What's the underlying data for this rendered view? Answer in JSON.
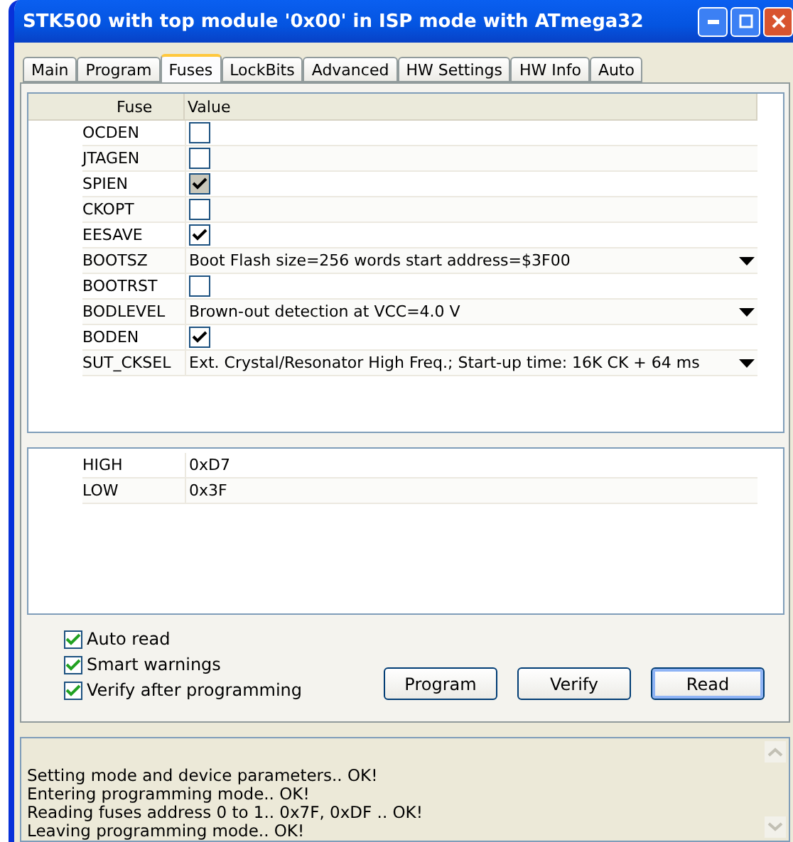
{
  "window": {
    "title": "STK500 with top module '0x00' in ISP mode with ATmega32"
  },
  "tabs": [
    {
      "label": "Main",
      "selected": false
    },
    {
      "label": "Program",
      "selected": false
    },
    {
      "label": "Fuses",
      "selected": true
    },
    {
      "label": "LockBits",
      "selected": false
    },
    {
      "label": "Advanced",
      "selected": false
    },
    {
      "label": "HW Settings",
      "selected": false
    },
    {
      "label": "HW Info",
      "selected": false
    },
    {
      "label": "Auto",
      "selected": false
    }
  ],
  "fuse_table": {
    "columns": [
      "Fuse",
      "Value"
    ],
    "rows": [
      {
        "name": "OCDEN",
        "kind": "checkbox",
        "checked": false,
        "disabled": false
      },
      {
        "name": "JTAGEN",
        "kind": "checkbox",
        "checked": false,
        "disabled": false
      },
      {
        "name": "SPIEN",
        "kind": "checkbox",
        "checked": true,
        "disabled": true
      },
      {
        "name": "CKOPT",
        "kind": "checkbox",
        "checked": false,
        "disabled": false
      },
      {
        "name": "EESAVE",
        "kind": "checkbox",
        "checked": true,
        "disabled": false
      },
      {
        "name": "BOOTSZ",
        "kind": "select",
        "value": "Boot Flash size=256 words start address=$3F00"
      },
      {
        "name": "BOOTRST",
        "kind": "checkbox",
        "checked": false,
        "disabled": false
      },
      {
        "name": "BODLEVEL",
        "kind": "select",
        "value": "Brown-out detection at VCC=4.0 V"
      },
      {
        "name": "BODEN",
        "kind": "checkbox",
        "checked": true,
        "disabled": false
      },
      {
        "name": "SUT_CKSEL",
        "kind": "select",
        "value": "Ext. Crystal/Resonator High Freq.; Start-up time: 16K CK + 64 ms"
      }
    ]
  },
  "fuse_bytes": [
    {
      "name": "HIGH",
      "value": "0xD7"
    },
    {
      "name": "LOW",
      "value": "0x3F"
    }
  ],
  "options": [
    {
      "label": "Auto read",
      "checked": true
    },
    {
      "label": "Smart warnings",
      "checked": true
    },
    {
      "label": "Verify after programming",
      "checked": true
    }
  ],
  "buttons": [
    {
      "label": "Program",
      "selected": false
    },
    {
      "label": "Verify",
      "selected": false
    },
    {
      "label": "Read",
      "selected": true
    }
  ],
  "log": [
    "Setting mode and device parameters.. OK!",
    "Entering programming mode.. OK!",
    "Reading fuses address 0 to 1.. 0x7F, 0xDF .. OK!",
    "Leaving programming mode.. OK!"
  ]
}
